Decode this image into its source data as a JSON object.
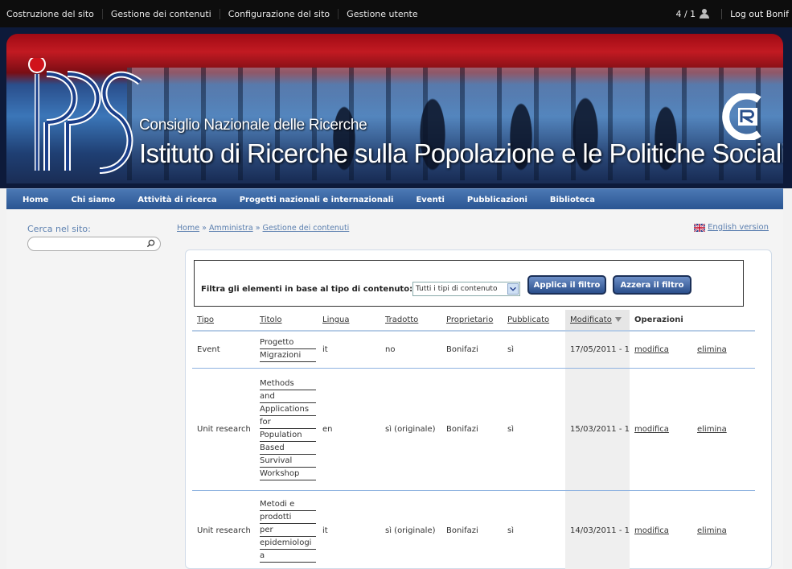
{
  "adminbar": {
    "menu": [
      "Costruzione del sito",
      "Gestione dei contenuti",
      "Configurazione del sito",
      "Gestione utente"
    ],
    "users": "4 / 1",
    "logout": "Log out Bonif"
  },
  "banner": {
    "subtitle": "Consiglio Nazionale delle Ricerche",
    "title": "Istituto di Ricerche sulla Popolazione e le Politiche Sociali"
  },
  "nav": [
    "Home",
    "Chi siamo",
    "Attività di ricerca",
    "Progetti nazionali e internazionali",
    "Eventi",
    "Pubblicazioni",
    "Biblioteca"
  ],
  "sidebar": {
    "search_label": "Cerca nel sito:",
    "search_value": ""
  },
  "breadcrumb": {
    "home": "Home",
    "sep": "»",
    "amministra": "Amministra",
    "current": "Gestione dei contenuti"
  },
  "english_link": "English version",
  "filter": {
    "label": "Filtra gli elementi in base al tipo di contenuto:",
    "select_value": "Tutti i tipi di contenuto",
    "apply": "Applica il filtro",
    "reset": "Azzera il filtro"
  },
  "table": {
    "headers": [
      "Tipo",
      "Titolo",
      "Lingua",
      "Tradotto",
      "Proprietario",
      "Pubblicato",
      "Modificato",
      "Operazioni"
    ],
    "rows": [
      {
        "tipo": "Event",
        "titolo": [
          "Progetto",
          "Migrazioni"
        ],
        "lingua": "it",
        "tradotto": "no",
        "proprietario": "Bonifazi",
        "pubblicato": "sì",
        "modificato": "17/05/2011 - 1",
        "modifica": "modifica",
        "elimina": "elimina"
      },
      {
        "tipo": "Unit research",
        "titolo": [
          "Methods",
          "and",
          "Applications",
          "for",
          "Population",
          "Based",
          "Survival",
          "Workshop"
        ],
        "lingua": "en",
        "tradotto": "sì (originale)",
        "proprietario": "Bonifazi",
        "pubblicato": "sì",
        "modificato": "15/03/2011 - 1",
        "modifica": "modifica",
        "elimina": "elimina"
      },
      {
        "tipo": "Unit research",
        "titolo": [
          "Metodi e",
          "prodotti",
          "per",
          "epidemiologi",
          "a"
        ],
        "lingua": "it",
        "tradotto": "sì (originale)",
        "proprietario": "Bonifazi",
        "pubblicato": "sì",
        "modificato": "14/03/2011 - 1",
        "modifica": "modifica",
        "elimina": "elimina"
      }
    ]
  }
}
